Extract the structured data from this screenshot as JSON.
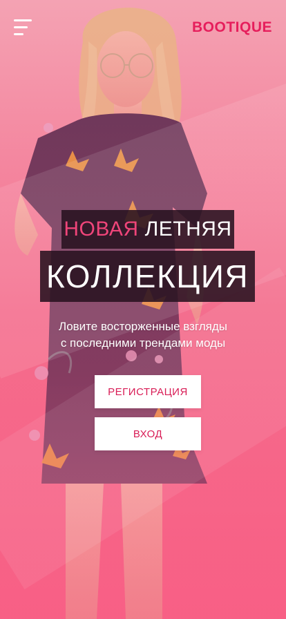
{
  "header": {
    "menu_icon": "hamburger-menu-icon",
    "logo_text": "BOOTIQUE"
  },
  "hero": {
    "headline_word1": "НОВАЯ",
    "headline_word2": "ЛЕТНЯЯ",
    "headline_line2": "КОЛЛЕКЦИЯ",
    "subtitle_line1": "Ловите восторженные взгляды",
    "subtitle_line2": "с последними трендами моды"
  },
  "actions": {
    "register_label": "РЕГИСТРАЦИЯ",
    "login_label": "ВХОД"
  },
  "colors": {
    "accent": "#e61e5c",
    "background": "#f06a8c",
    "headline_box": "#28121f"
  }
}
